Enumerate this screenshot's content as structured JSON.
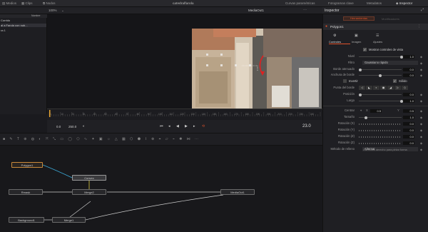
{
  "topbar": {
    "media_pool": "Medios",
    "clips": "Clips",
    "nodes": "Nodos",
    "title": "catedralfarola",
    "curves": "Curvas paramétricas",
    "keyframes": "Fotogramas clave",
    "metadata": "Metadatos",
    "inspector": "Inspector"
  },
  "toolbar2": {
    "zoom": "100%",
    "viewer_name": "MediaOut1",
    "inspector_label": "Inspector"
  },
  "leftpanel": {
    "items": [
      "Corrido",
      "al a Farola con nub...",
      "ra 1"
    ],
    "sort_label": "Nombre"
  },
  "timeline": {
    "ticks": [
      "0",
      "10",
      "20",
      "30",
      "40",
      "50",
      "60",
      "70",
      "80",
      "90",
      "100",
      "110",
      "120",
      "130",
      "140",
      "150",
      "160",
      "170",
      "180",
      "190",
      "200",
      "210",
      "220",
      "230",
      "240"
    ]
  },
  "transport": {
    "start": "0.0",
    "end": "250.0",
    "current": "23.0"
  },
  "nodes": {
    "polygon": "Polygon1",
    "convex": "Convex",
    "remove": "Rmask",
    "merge2": "Merge2",
    "mediaout": "MediaOut1",
    "background": "Background1",
    "merge1": "Merge1"
  },
  "inspector": {
    "tabs": [
      "Herramientas",
      "Modificadores"
    ],
    "node_title": "Polygon1",
    "subtabs": [
      "Controles",
      "Imagen",
      "Ajustes"
    ],
    "show_view": "Mostrar controles de vista",
    "rows": [
      {
        "label": "Nivel",
        "value": "1.0"
      },
      {
        "label": "Filtro",
        "value": "Gaussiano rápido"
      },
      {
        "label": "Borde atenuado",
        "value": "0.0"
      },
      {
        "label": "Anchura de borde",
        "value": "0.0"
      },
      {
        "label": "",
        "value": ""
      },
      {
        "label": "Punta del borde",
        "value": ""
      },
      {
        "label": "Posición",
        "value": "0.0"
      },
      {
        "label": "Largo",
        "value": "1.0"
      }
    ],
    "invert_label": "Invertir",
    "solid_label": "Sólido",
    "rows2": [
      {
        "label": "Centrar",
        "x": "0.5",
        "y": "0.5"
      },
      {
        "label": "Tamaño",
        "value": "1.0"
      },
      {
        "label": "Rotación (X)",
        "value": "0.0"
      },
      {
        "label": "Rotación (Y)",
        "value": "0.0"
      },
      {
        "label": "Rotación (Z)",
        "value": "0.0"
      },
      {
        "label": "Rotación (Z)",
        "value": "0.0"
      },
      {
        "label": "Método de relleno",
        "value": "Alternar"
      }
    ],
    "footer_note": "Clic botón derecho para pintar forma"
  },
  "colors": {
    "accent": "#e0522b",
    "panel": "#1f1f23",
    "node_selected": "#c98a3a"
  }
}
